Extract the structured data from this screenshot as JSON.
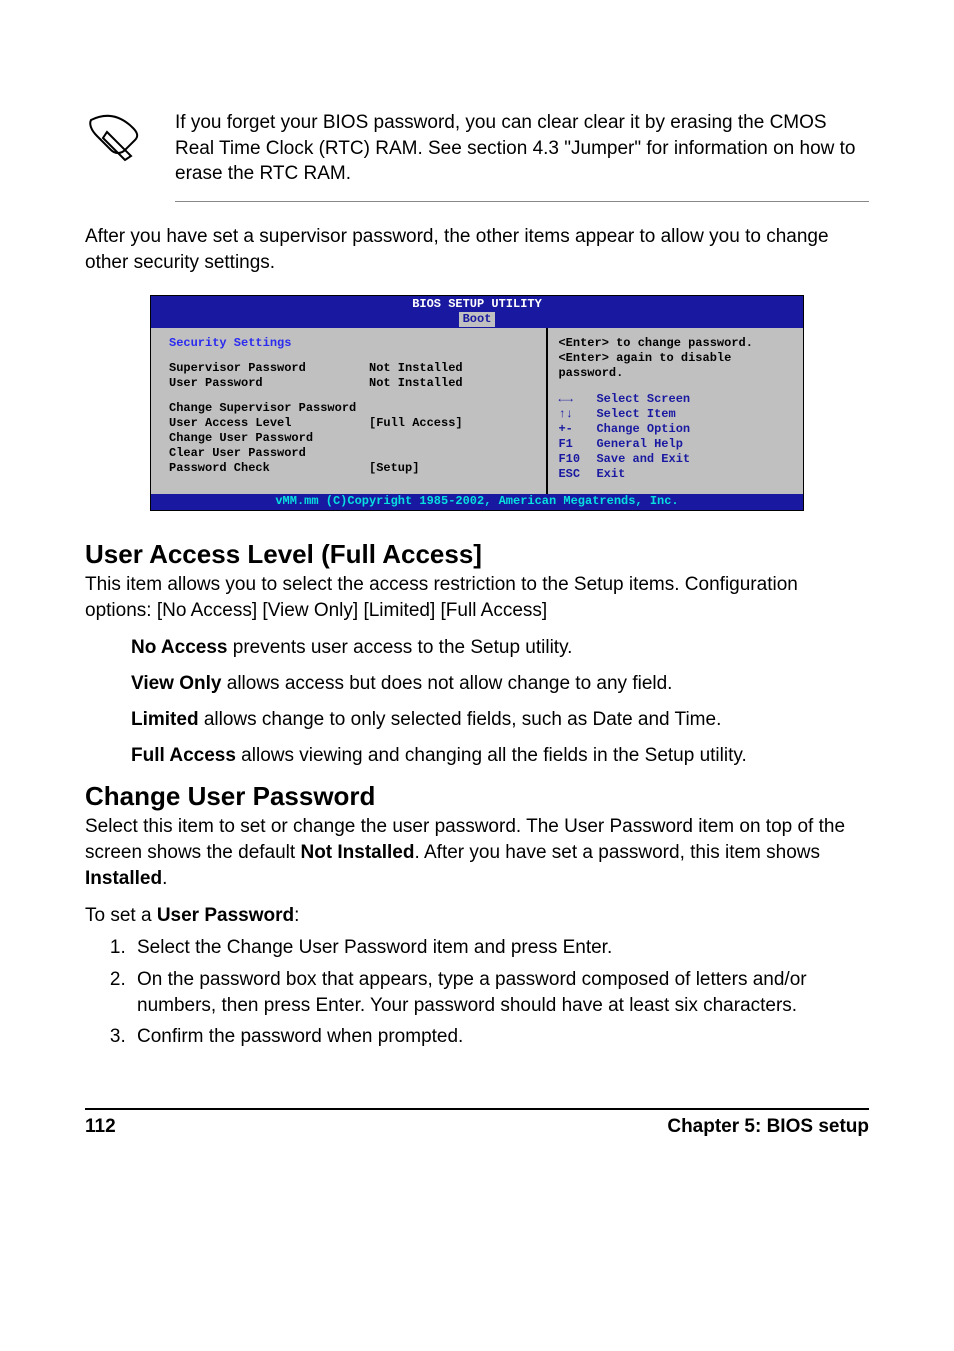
{
  "note": {
    "text": "If you forget your BIOS password, you can clear clear it by erasing the CMOS Real Time Clock (RTC) RAM. See section 4.3 \"Jumper\" for information on how to erase the RTC RAM."
  },
  "intro_para": "After you have set a supervisor password, the other items appear to allow you to change other security settings.",
  "bios": {
    "title": "BIOS SETUP UTILITY",
    "menu_selected": "Boot",
    "section": "Security Settings",
    "rows_group1": [
      {
        "label": "Supervisor Password",
        "value": "Not Installed"
      },
      {
        "label": "User Password",
        "value": "Not Installed"
      }
    ],
    "rows_group2": [
      {
        "label": "Change Supervisor Password",
        "value": ""
      },
      {
        "label": "User Access Level",
        "value": "[Full Access]"
      },
      {
        "label": "Change User Password",
        "value": ""
      },
      {
        "label": "Clear User Password",
        "value": ""
      },
      {
        "label": "Password Check",
        "value": "[Setup]"
      }
    ],
    "help_top": "<Enter> to change password.\n<Enter> again to disable password.",
    "help_keys": [
      {
        "key": "←→",
        "desc": "Select Screen"
      },
      {
        "key": "↑↓",
        "desc": "Select Item"
      },
      {
        "key": "+-",
        "desc": "Change Option"
      },
      {
        "key": "F1",
        "desc": "General Help"
      },
      {
        "key": "F10",
        "desc": "Save and Exit"
      },
      {
        "key": "ESC",
        "desc": "Exit"
      }
    ],
    "footer": "vMM.mm (C)Copyright 1985-2002, American Megatrends, Inc."
  },
  "sections": {
    "ual": {
      "heading": "User Access Level (Full Access]",
      "desc": "This item allows you to select the access restriction to the Setup items. Configuration options: [No Access] [View Only] [Limited] [Full Access]",
      "items": [
        {
          "b": "No Access",
          "rest": " prevents user access to the Setup utility."
        },
        {
          "b": "View Only",
          "rest": " allows access but does not allow change to any field."
        },
        {
          "b": "Limited",
          "rest": " allows change to only selected fields, such as Date and Time."
        },
        {
          "b": "Full Access",
          "rest": " allows viewing and changing all the fields in the Setup utility."
        }
      ]
    },
    "cup": {
      "heading": "Change User Password",
      "desc_pre": "Select this item to set or change the user password. The User Password item on top of the screen shows the default ",
      "desc_b1": "Not Installed",
      "desc_mid": ". After you have set a password, this item shows ",
      "desc_b2": "Installed",
      "desc_post": ".",
      "to_set_pre": "To set a ",
      "to_set_b": "User Password",
      "to_set_post": ":",
      "steps": [
        "Select the Change User Password item and press Enter.",
        "On the password box that appears, type a password composed of letters and/or numbers, then press Enter. Your password should have at least six characters.",
        "Confirm the password when prompted."
      ]
    }
  },
  "footer": {
    "page_no": "112",
    "chapter": "Chapter 5: BIOS setup"
  }
}
